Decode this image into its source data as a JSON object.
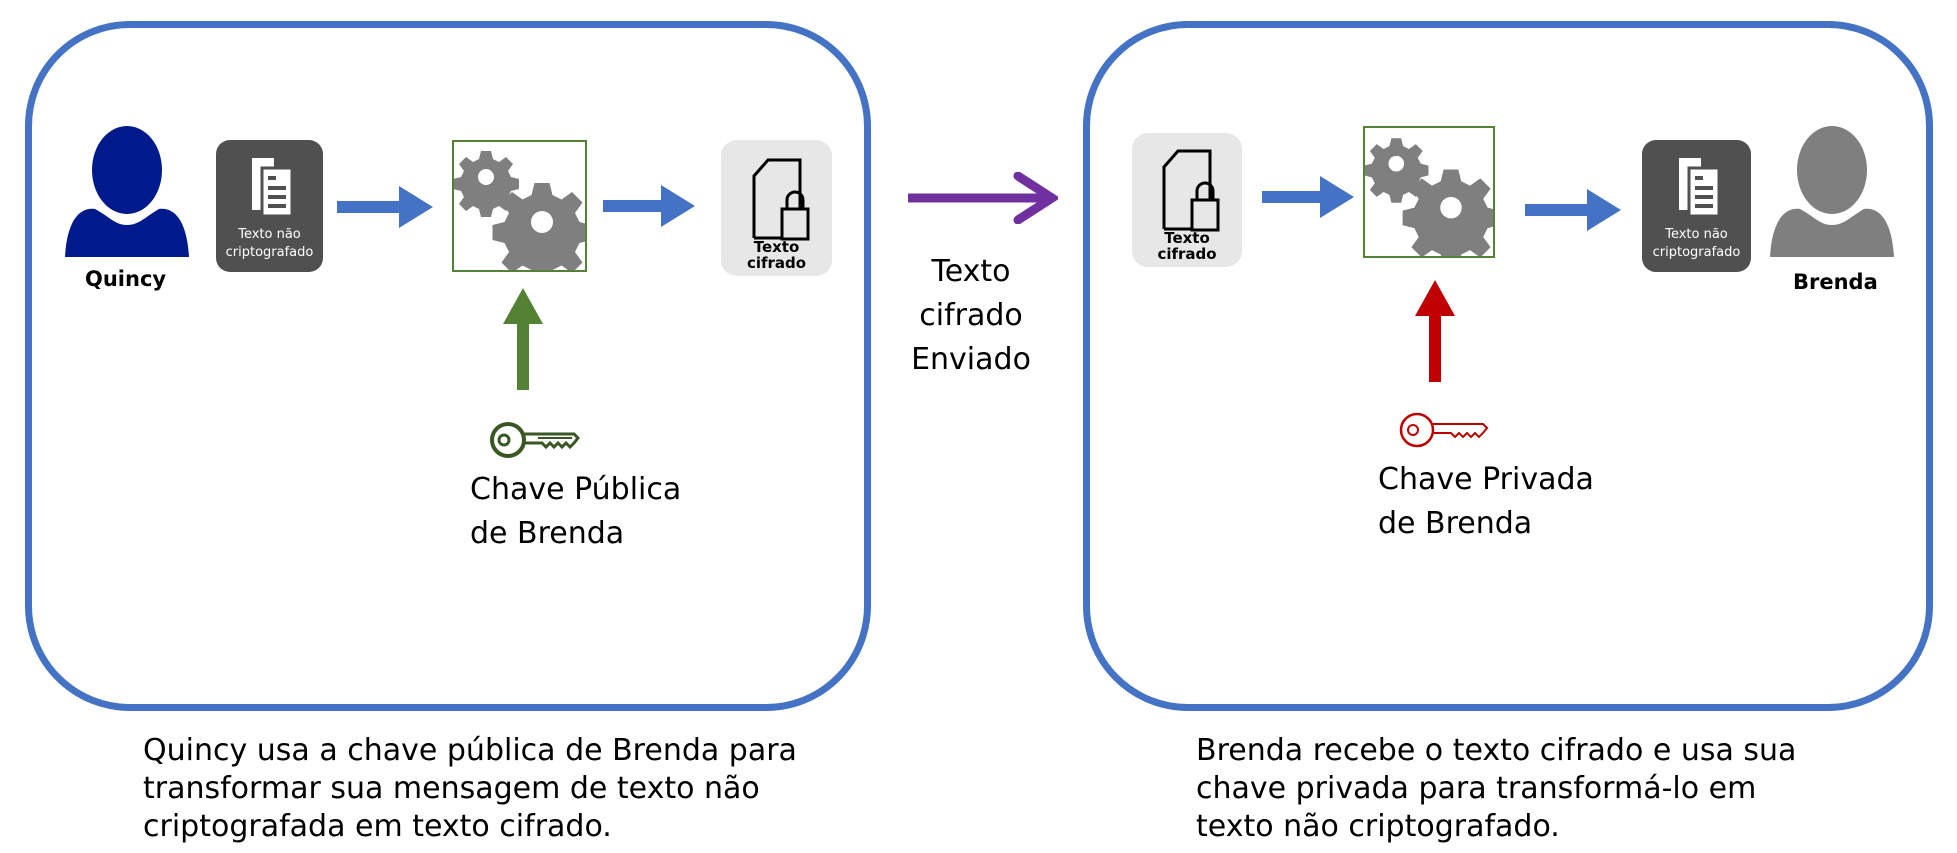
{
  "colors": {
    "panel_border": "#4472C4",
    "flow_arrow": "#4472C4",
    "sent_arrow": "#7030A0",
    "public_key": "#548235",
    "private_key": "#C00000",
    "quincy": "#001A8C",
    "brenda": "#7F7F7F",
    "gear": "#7F7F7F"
  },
  "left": {
    "person": "Quincy",
    "plaintext_icon": {
      "line1": "Texto não",
      "line2": "criptografado"
    },
    "ciphertext_icon": {
      "line1": "Texto",
      "line2": "cifrado"
    },
    "key_label": {
      "line1": "Chave Pública",
      "line2": "de Brenda"
    },
    "caption": {
      "line1": "Quincy usa a chave pública de Brenda para",
      "line2": "transformar sua mensagem de texto não",
      "line3": "criptografada em texto cifrado."
    }
  },
  "middle": {
    "line1": "Texto",
    "line2": "cifrado",
    "line3": "Enviado"
  },
  "right": {
    "person": "Brenda",
    "ciphertext_icon": {
      "line1": "Texto",
      "line2": "cifrado"
    },
    "plaintext_icon": {
      "line1": "Texto não",
      "line2": "criptografado"
    },
    "key_label": {
      "line1": "Chave Privada",
      "line2": "de Brenda"
    },
    "caption": {
      "line1": "Brenda recebe o texto cifrado e usa sua",
      "line2": "chave privada para transformá-lo em",
      "line3": "texto não criptografado."
    }
  }
}
